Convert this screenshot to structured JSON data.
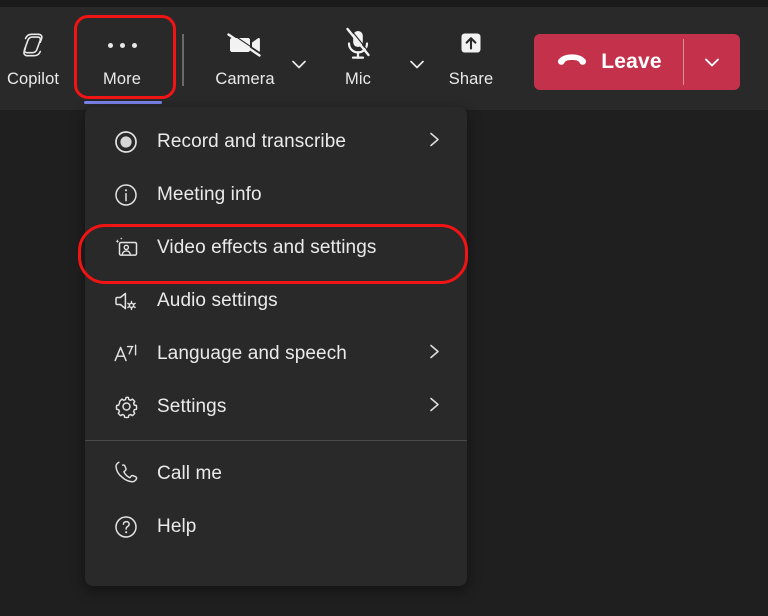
{
  "app": {
    "theme_background": "#1f1f1f",
    "panel_background": "#292929",
    "accent_underline": "#7b83eb",
    "leave_button_color": "#c4314b",
    "annotation_color": "#f11414"
  },
  "toolbar": {
    "items": [
      {
        "id": "copilot",
        "label": "Copilot",
        "icon": "copilot-icon",
        "state": "off"
      },
      {
        "id": "more",
        "label": "More",
        "icon": "more-dots-icon",
        "state": "active"
      },
      {
        "id": "camera",
        "label": "Camera",
        "icon": "camera-off-icon",
        "state": "muted"
      },
      {
        "id": "mic",
        "label": "Mic",
        "icon": "mic-off-icon",
        "state": "muted"
      },
      {
        "id": "share",
        "label": "Share",
        "icon": "share-screen-icon",
        "state": "off"
      }
    ],
    "camera_caret_icon": "chevron-down-icon",
    "mic_caret_icon": "chevron-down-icon",
    "leave": {
      "label": "Leave",
      "icon": "hang-up-icon",
      "caret_icon": "chevron-down-icon"
    }
  },
  "menu": {
    "groups": [
      {
        "items": [
          {
            "label": "Record and transcribe",
            "icon": "record-icon",
            "submenu": true
          },
          {
            "label": "Meeting info",
            "icon": "info-icon",
            "submenu": false
          },
          {
            "label": "Video effects and settings",
            "icon": "video-effects-icon",
            "submenu": false,
            "highlighted": true
          },
          {
            "label": "Audio settings",
            "icon": "speaker-settings-icon",
            "submenu": false
          },
          {
            "label": "Language and speech",
            "icon": "language-icon",
            "submenu": true
          },
          {
            "label": "Settings",
            "icon": "gear-icon",
            "submenu": true
          }
        ]
      },
      {
        "items": [
          {
            "label": "Call me",
            "icon": "phone-icon",
            "submenu": false
          },
          {
            "label": "Help",
            "icon": "help-icon",
            "submenu": false
          }
        ]
      }
    ]
  },
  "annotations": [
    {
      "target": "more-button",
      "shape": "rounded-rect",
      "color": "#f11414"
    },
    {
      "target": "menu-item-video-effects-and-settings",
      "shape": "rounded-pill",
      "color": "#f11414"
    }
  ]
}
